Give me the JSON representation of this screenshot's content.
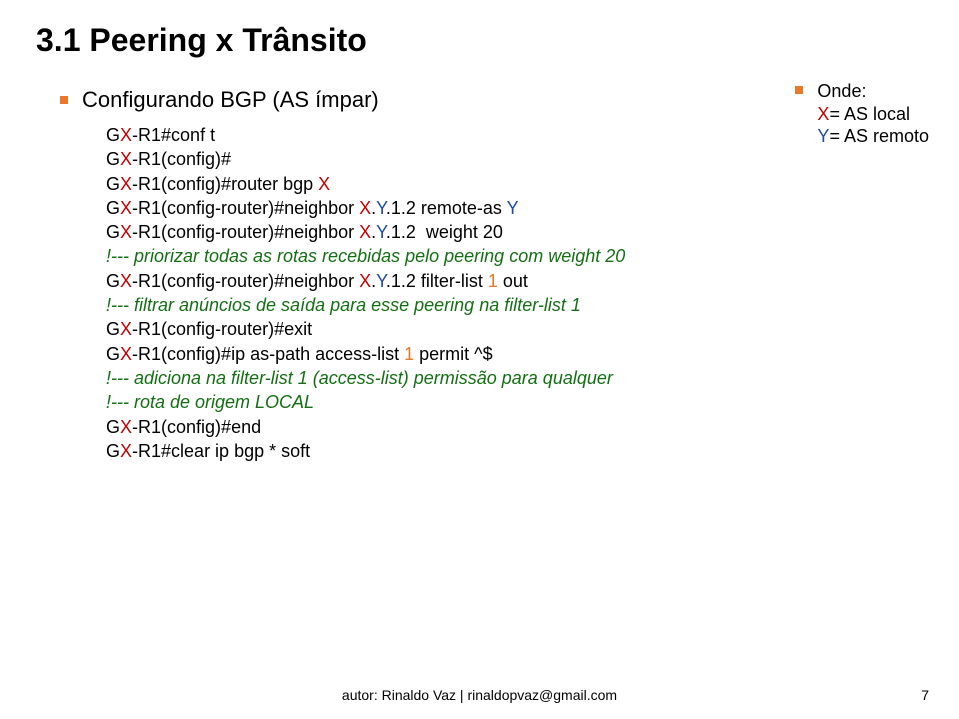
{
  "title": "3.1 Peering x Trânsito",
  "subtitle": "Configurando BGP (AS ímpar)",
  "onde": {
    "label": "Onde:",
    "x_line_pre": "X",
    "x_line_post": "= AS local",
    "y_line_pre": "Y",
    "y_line_post": "= AS remoto"
  },
  "lines": {
    "l1_a": "G",
    "l1_b": "X",
    "l1_c": "-R1#conf t",
    "l2_a": "G",
    "l2_b": "X",
    "l2_c": "-R1(config)#",
    "l3_a": "G",
    "l3_b": "X",
    "l3_c": "-R1(config)#router bgp ",
    "l3_d": "X",
    "l4_a": "G",
    "l4_b": "X",
    "l4_c": "-R1(config-router)#neighbor ",
    "l4_d": "X",
    "l4_e": ".",
    "l4_f": "Y",
    "l4_g": ".1.2 remote-as ",
    "l4_h": "Y",
    "l5_a": "G",
    "l5_b": "X",
    "l5_c": "-R1(config-router)#neighbor ",
    "l5_d": "X",
    "l5_e": ".",
    "l5_f": "Y",
    "l5_g": ".1.2  weight 20",
    "c1": "!--- priorizar todas as rotas recebidas pelo peering com weight 20",
    "l6_a": "G",
    "l6_b": "X",
    "l6_c": "-R1(config-router)#neighbor ",
    "l6_d": "X",
    "l6_e": ".",
    "l6_f": "Y",
    "l6_g": ".1.2 filter-list ",
    "l6_h": "1",
    "l6_i": " out",
    "c2": "!--- filtrar anúncios de saída para esse peering na filter-list 1",
    "l7_a": "G",
    "l7_b": "X",
    "l7_c": "-R1(config-router)#exit",
    "l8_a": "G",
    "l8_b": "X",
    "l8_c": "-R1(config)#ip as-path access-list ",
    "l8_d": "1",
    "l8_e": " permit ",
    "l8_f": "^$",
    "c3": "!--- adiciona na filter-list 1 (access-list) permissão para qualquer",
    "c4": "!--- rota de origem LOCAL",
    "l9_a": "G",
    "l9_b": "X",
    "l9_c": "-R1(config)#end",
    "l10_a": "G",
    "l10_b": "X",
    "l10_c": "-R1#clear ip bgp * soft"
  },
  "footer": "autor: Rinaldo Vaz | rinaldopvaz@gmail.com",
  "page_number": "7"
}
